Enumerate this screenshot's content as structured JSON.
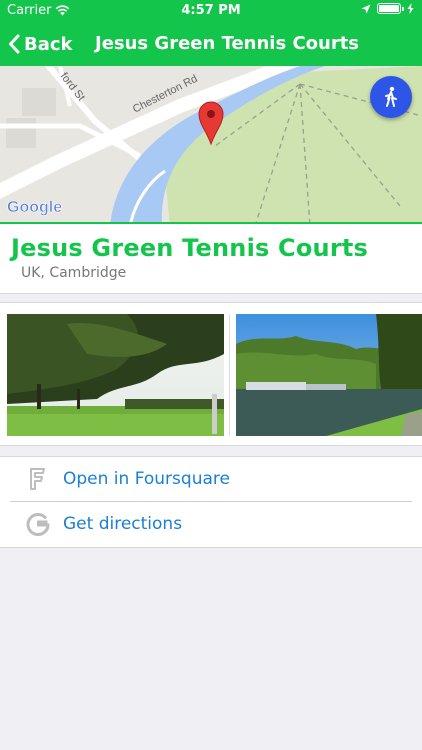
{
  "status_bar": {
    "carrier": "Carrier",
    "time": "4:57 PM",
    "icons": [
      "wifi-icon",
      "location-arrow-icon",
      "battery-icon",
      "charging-bolt-icon"
    ]
  },
  "nav": {
    "back_label": "Back",
    "title": "Jesus Green Tennis Courts"
  },
  "map": {
    "street_labels": [
      "Chesterton Rd",
      "ford St"
    ],
    "attribution": "Google",
    "icons": [
      "map-pin-icon",
      "walking-person-icon"
    ],
    "colors": {
      "park": "#cfe3b0",
      "river": "#a8c9f4",
      "pin": "#e53935",
      "walk_button": "#2d56e8"
    }
  },
  "place": {
    "title": "Jesus Green Tennis Courts",
    "subtitle": "UK, Cambridge"
  },
  "photos": [
    "park-with-trees-photo",
    "river-with-boats-photo"
  ],
  "actions": [
    {
      "icon": "foursquare-icon",
      "label": "Open in Foursquare"
    },
    {
      "icon": "google-g-icon",
      "label": "Get directions"
    }
  ],
  "colors": {
    "accent": "#14c54c",
    "link": "#1a7fd6",
    "background": "#efeff4"
  }
}
